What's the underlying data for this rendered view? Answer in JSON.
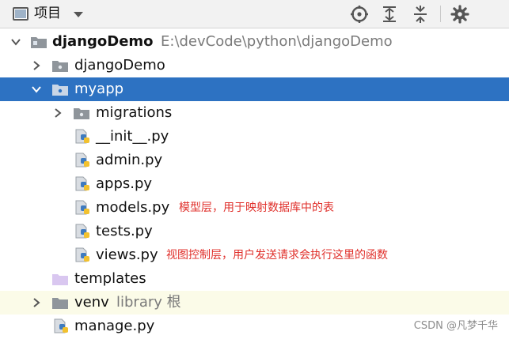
{
  "toolbar": {
    "title": "项目",
    "icons": [
      "project-view-icon",
      "locate-icon",
      "expand-all-icon",
      "collapse-all-icon",
      "settings-icon"
    ]
  },
  "tree": {
    "root": {
      "name": "djangoDemo",
      "path": "E:\\devCode\\python\\djangoDemo"
    },
    "djangodemo_folder": "djangoDemo",
    "myapp": "myapp",
    "migrations": "migrations",
    "files": {
      "init": "__init__.py",
      "admin": "admin.py",
      "apps": "apps.py",
      "models": "models.py",
      "tests": "tests.py",
      "views": "views.py"
    },
    "templates": "templates",
    "venv": {
      "name": "venv",
      "extra": "library 根"
    },
    "manage": "manage.py"
  },
  "annotations": {
    "models": "模型层，用于映射数据库中的表",
    "views": "视图控制层，用户发送请求会执行这里的函数"
  },
  "watermark": "CSDN @凡梦千华",
  "colors": {
    "selection": "#2d72c2",
    "annotation": "#e0302b",
    "templates_folder": "#d9c7f0",
    "library_row": "#fbfbe8"
  }
}
